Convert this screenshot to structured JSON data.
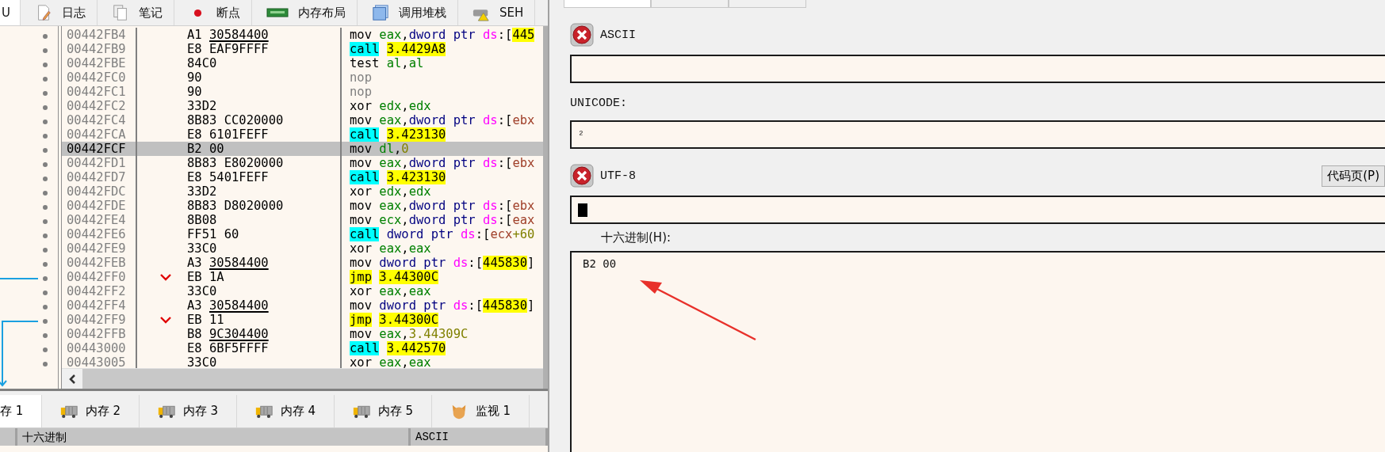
{
  "top_tabs": [
    {
      "label": "U",
      "selected": true
    },
    {
      "label": "日志",
      "selected": false,
      "kind": "log"
    },
    {
      "label": "笔记",
      "selected": false,
      "kind": "notes"
    },
    {
      "label": "断点",
      "selected": false,
      "kind": "breakpoint"
    },
    {
      "label": "内存布局",
      "selected": false,
      "kind": "memmap"
    },
    {
      "label": "调用堆栈",
      "selected": false,
      "kind": "callstack"
    },
    {
      "label": "SEH",
      "selected": false,
      "kind": "seh"
    }
  ],
  "disassembly": {
    "rows": [
      {
        "address": "00442FB4",
        "selected": false,
        "jump": false,
        "bytes": [
          "A1",
          "30584400"
        ],
        "reloc": true,
        "instruction": [
          {
            "text": "mov",
            "kind": "mnem"
          },
          {
            "text": "eax",
            "kind": "reg"
          },
          {
            "text": ",",
            "kind": "punct"
          },
          {
            "text": "dword ptr",
            "kind": "ptr"
          },
          {
            "text": "ds",
            "kind": "seg"
          },
          {
            "text": ":",
            "kind": "punct"
          },
          {
            "text": "[",
            "kind": "punct"
          },
          {
            "text": "445",
            "kind": "addr"
          }
        ]
      },
      {
        "address": "00442FB9",
        "selected": false,
        "jump": false,
        "bytes": [
          "E8",
          "EAF9FFFF"
        ],
        "reloc": false,
        "instruction": [
          {
            "text": "call",
            "kind": "call"
          },
          {
            "text": "3.4429A8",
            "kind": "addr"
          }
        ]
      },
      {
        "address": "00442FBE",
        "selected": false,
        "jump": false,
        "bytes": [
          "84C0"
        ],
        "instruction": [
          {
            "text": "test",
            "kind": "mnem"
          },
          {
            "text": "al",
            "kind": "reg"
          },
          {
            "text": ",",
            "kind": "punct"
          },
          {
            "text": "al",
            "kind": "reg"
          }
        ]
      },
      {
        "address": "00442FC0",
        "selected": false,
        "jump": false,
        "bytes": [
          "90"
        ],
        "instruction": [
          {
            "text": "nop",
            "kind": "nop"
          }
        ]
      },
      {
        "address": "00442FC1",
        "selected": false,
        "jump": false,
        "bytes": [
          "90"
        ],
        "instruction": [
          {
            "text": "nop",
            "kind": "nop"
          }
        ]
      },
      {
        "address": "00442FC2",
        "selected": false,
        "jump": false,
        "bytes": [
          "33D2"
        ],
        "instruction": [
          {
            "text": "xor",
            "kind": "mnem"
          },
          {
            "text": "edx",
            "kind": "reg"
          },
          {
            "text": ",",
            "kind": "punct"
          },
          {
            "text": "edx",
            "kind": "reg"
          }
        ]
      },
      {
        "address": "00442FC4",
        "selected": false,
        "jump": false,
        "bytes": [
          "8B83",
          "CC020000"
        ],
        "reloc": false,
        "instruction": [
          {
            "text": "mov",
            "kind": "mnem"
          },
          {
            "text": "eax",
            "kind": "reg"
          },
          {
            "text": ",",
            "kind": "punct"
          },
          {
            "text": "dword ptr",
            "kind": "ptr"
          },
          {
            "text": "ds",
            "kind": "seg"
          },
          {
            "text": ":",
            "kind": "punct"
          },
          {
            "text": "[",
            "kind": "punct"
          },
          {
            "text": "ebx",
            "kind": "mem"
          }
        ]
      },
      {
        "address": "00442FCA",
        "selected": false,
        "jump": false,
        "bytes": [
          "E8",
          "6101FEFF"
        ],
        "reloc": false,
        "instruction": [
          {
            "text": "call",
            "kind": "call"
          },
          {
            "text": "3.423130",
            "kind": "addr"
          }
        ]
      },
      {
        "address": "00442FCF",
        "selected": true,
        "jump": false,
        "bytes": [
          "B2",
          "00"
        ],
        "reloc": false,
        "instruction": [
          {
            "text": "mov",
            "kind": "mnem"
          },
          {
            "text": "dl",
            "kind": "reg"
          },
          {
            "text": ",",
            "kind": "punct"
          },
          {
            "text": "0",
            "kind": "num"
          }
        ]
      },
      {
        "address": "00442FD1",
        "selected": false,
        "jump": false,
        "bytes": [
          "8B83",
          "E8020000"
        ],
        "reloc": false,
        "instruction": [
          {
            "text": "mov",
            "kind": "mnem"
          },
          {
            "text": "eax",
            "kind": "reg"
          },
          {
            "text": ",",
            "kind": "punct"
          },
          {
            "text": "dword ptr",
            "kind": "ptr"
          },
          {
            "text": "ds",
            "kind": "seg"
          },
          {
            "text": ":",
            "kind": "punct"
          },
          {
            "text": "[",
            "kind": "punct"
          },
          {
            "text": "ebx",
            "kind": "mem"
          }
        ]
      },
      {
        "address": "00442FD7",
        "selected": false,
        "jump": false,
        "bytes": [
          "E8",
          "5401FEFF"
        ],
        "reloc": false,
        "instruction": [
          {
            "text": "call",
            "kind": "call"
          },
          {
            "text": "3.423130",
            "kind": "addr"
          }
        ]
      },
      {
        "address": "00442FDC",
        "selected": false,
        "jump": false,
        "bytes": [
          "33D2"
        ],
        "instruction": [
          {
            "text": "xor",
            "kind": "mnem"
          },
          {
            "text": "edx",
            "kind": "reg"
          },
          {
            "text": ",",
            "kind": "punct"
          },
          {
            "text": "edx",
            "kind": "reg"
          }
        ]
      },
      {
        "address": "00442FDE",
        "selected": false,
        "jump": false,
        "bytes": [
          "8B83",
          "D8020000"
        ],
        "reloc": false,
        "instruction": [
          {
            "text": "mov",
            "kind": "mnem"
          },
          {
            "text": "eax",
            "kind": "reg"
          },
          {
            "text": ",",
            "kind": "punct"
          },
          {
            "text": "dword ptr",
            "kind": "ptr"
          },
          {
            "text": "ds",
            "kind": "seg"
          },
          {
            "text": ":",
            "kind": "punct"
          },
          {
            "text": "[",
            "kind": "punct"
          },
          {
            "text": "ebx",
            "kind": "mem"
          }
        ]
      },
      {
        "address": "00442FE4",
        "selected": false,
        "jump": false,
        "bytes": [
          "8B08"
        ],
        "instruction": [
          {
            "text": "mov",
            "kind": "mnem"
          },
          {
            "text": "ecx",
            "kind": "reg"
          },
          {
            "text": ",",
            "kind": "punct"
          },
          {
            "text": "dword ptr",
            "kind": "ptr"
          },
          {
            "text": "ds",
            "kind": "seg"
          },
          {
            "text": ":",
            "kind": "punct"
          },
          {
            "text": "[",
            "kind": "punct"
          },
          {
            "text": "eax",
            "kind": "mem"
          }
        ]
      },
      {
        "address": "00442FE6",
        "selected": false,
        "jump": false,
        "bytes": [
          "FF51",
          "60"
        ],
        "reloc": false,
        "instruction": [
          {
            "text": "call",
            "kind": "call"
          },
          {
            "text": "dword ptr",
            "kind": "ptr"
          },
          {
            "text": "ds",
            "kind": "seg"
          },
          {
            "text": ":",
            "kind": "punct"
          },
          {
            "text": "[",
            "kind": "punct"
          },
          {
            "text": "ecx",
            "kind": "mem"
          },
          {
            "text": "+60",
            "kind": "offset"
          }
        ]
      },
      {
        "address": "00442FE9",
        "selected": false,
        "jump": false,
        "bytes": [
          "33C0"
        ],
        "instruction": [
          {
            "text": "xor",
            "kind": "mnem"
          },
          {
            "text": "eax",
            "kind": "reg"
          },
          {
            "text": ",",
            "kind": "punct"
          },
          {
            "text": "eax",
            "kind": "reg"
          }
        ]
      },
      {
        "address": "00442FEB",
        "selected": false,
        "jump": false,
        "bytes": [
          "A3",
          "30584400"
        ],
        "reloc": true,
        "instruction": [
          {
            "text": "mov",
            "kind": "mnem"
          },
          {
            "text": "dword ptr",
            "kind": "ptr"
          },
          {
            "text": "ds",
            "kind": "seg"
          },
          {
            "text": ":",
            "kind": "punct"
          },
          {
            "text": "[",
            "kind": "punct"
          },
          {
            "text": "445830",
            "kind": "addr"
          },
          {
            "text": "]",
            "kind": "punct"
          }
        ]
      },
      {
        "address": "00442FF0",
        "selected": false,
        "jump": true,
        "bytes": [
          "EB",
          "1A"
        ],
        "reloc": false,
        "instruction": [
          {
            "text": "jmp",
            "kind": "jmp"
          },
          {
            "text": "3.44300C",
            "kind": "addr"
          }
        ]
      },
      {
        "address": "00442FF2",
        "selected": false,
        "jump": false,
        "bytes": [
          "33C0"
        ],
        "instruction": [
          {
            "text": "xor",
            "kind": "mnem"
          },
          {
            "text": "eax",
            "kind": "reg"
          },
          {
            "text": ",",
            "kind": "punct"
          },
          {
            "text": "eax",
            "kind": "reg"
          }
        ]
      },
      {
        "address": "00442FF4",
        "selected": false,
        "jump": false,
        "bytes": [
          "A3",
          "30584400"
        ],
        "reloc": true,
        "instruction": [
          {
            "text": "mov",
            "kind": "mnem"
          },
          {
            "text": "dword ptr",
            "kind": "ptr"
          },
          {
            "text": "ds",
            "kind": "seg"
          },
          {
            "text": ":",
            "kind": "punct"
          },
          {
            "text": "[",
            "kind": "punct"
          },
          {
            "text": "445830",
            "kind": "addr"
          },
          {
            "text": "]",
            "kind": "punct"
          }
        ]
      },
      {
        "address": "00442FF9",
        "selected": false,
        "jump": true,
        "bytes": [
          "EB",
          "11"
        ],
        "reloc": false,
        "instruction": [
          {
            "text": "jmp",
            "kind": "jmp"
          },
          {
            "text": "3.44300C",
            "kind": "addr"
          }
        ]
      },
      {
        "address": "00442FFB",
        "selected": false,
        "jump": false,
        "bytes": [
          "B8",
          "9C304400"
        ],
        "reloc": true,
        "instruction": [
          {
            "text": "mov",
            "kind": "mnem"
          },
          {
            "text": "eax",
            "kind": "reg"
          },
          {
            "text": ",",
            "kind": "punct"
          },
          {
            "text": "3.44309C",
            "kind": "num"
          }
        ]
      },
      {
        "address": "00443000",
        "selected": false,
        "jump": false,
        "bytes": [
          "E8",
          "6BF5FFFF"
        ],
        "reloc": false,
        "instruction": [
          {
            "text": "call",
            "kind": "call"
          },
          {
            "text": "3.442570",
            "kind": "addr"
          }
        ]
      },
      {
        "address": "00443005",
        "selected": false,
        "jump": false,
        "bytes": [
          "33C0"
        ],
        "instruction": [
          {
            "text": "xor",
            "kind": "mnem"
          },
          {
            "text": "eax",
            "kind": "reg"
          },
          {
            "text": ",",
            "kind": "punct"
          },
          {
            "text": "eax",
            "kind": "reg"
          }
        ]
      }
    ]
  },
  "bottom_tabs": [
    {
      "label": "存 1",
      "selected": true
    },
    {
      "label": "内存 2",
      "selected": false,
      "kind": "memory"
    },
    {
      "label": "内存 3",
      "selected": false,
      "kind": "memory"
    },
    {
      "label": "内存 4",
      "selected": false,
      "kind": "memory"
    },
    {
      "label": "内存 5",
      "selected": false,
      "kind": "memory"
    },
    {
      "label": "监视 1",
      "selected": false,
      "kind": "watch"
    }
  ],
  "dump": {
    "columns": [
      "十六进制",
      "ASCII"
    ]
  },
  "edit_panel": {
    "tabs": [
      {
        "selected": true
      },
      {
        "selected": false
      },
      {
        "selected": false
      }
    ],
    "ascii": {
      "label": "ASCII",
      "invalid": true
    },
    "unicode": {
      "label": "UNICODE:",
      "value": "²"
    },
    "utf8": {
      "label": "UTF-8",
      "invalid": true,
      "button": "代码页(P)",
      "caret": true
    },
    "hex": {
      "label": "十六进制(H):",
      "value": "B2 00"
    }
  }
}
